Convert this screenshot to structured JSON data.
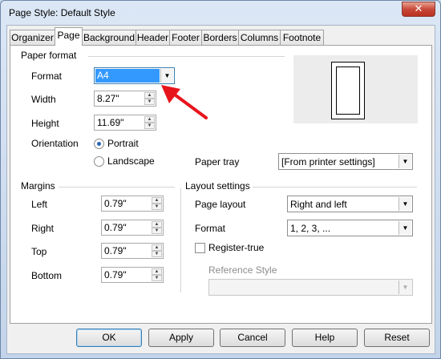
{
  "window": {
    "title": "Page Style: Default Style",
    "close_glyph": "✕"
  },
  "tabs": [
    "Organizer",
    "Page",
    "Background",
    "Header",
    "Footer",
    "Borders",
    "Columns",
    "Footnote"
  ],
  "paper_format": {
    "heading": "Paper format",
    "format_label": "Format",
    "format_value": "A4",
    "width_label": "Width",
    "width_value": "8.27\"",
    "height_label": "Height",
    "height_value": "11.69\"",
    "orientation_label": "Orientation",
    "portrait_label": "Portrait",
    "landscape_label": "Landscape",
    "paper_tray_label": "Paper tray",
    "paper_tray_value": "[From printer settings]"
  },
  "margins": {
    "heading": "Margins",
    "left_label": "Left",
    "left_value": "0.79\"",
    "right_label": "Right",
    "right_value": "0.79\"",
    "top_label": "Top",
    "top_value": "0.79\"",
    "bottom_label": "Bottom",
    "bottom_value": "0.79\""
  },
  "layout": {
    "heading": "Layout settings",
    "page_layout_label": "Page layout",
    "page_layout_value": "Right and left",
    "format_label": "Format",
    "format_value": "1, 2, 3, ...",
    "register_true_label": "Register-true",
    "reference_style_label": "Reference Style",
    "reference_style_value": ""
  },
  "buttons": {
    "ok": "OK",
    "apply": "Apply",
    "cancel": "Cancel",
    "help": "Help",
    "reset": "Reset"
  },
  "colors": {
    "selection": "#3399ff",
    "annotation_arrow": "#e8141c",
    "close_button": "#c9493a"
  }
}
